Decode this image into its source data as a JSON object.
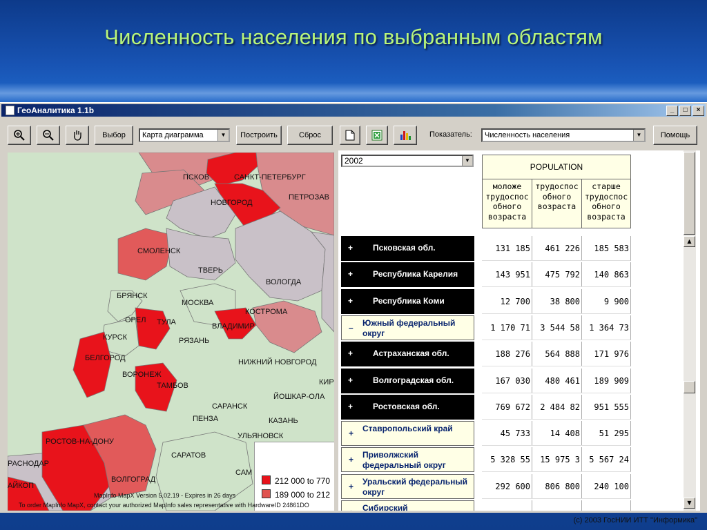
{
  "slide": {
    "title": "Численность населения по выбранным областям",
    "copyright": "(c) 2003 ГосНИИ ИТТ \"Информика\""
  },
  "window": {
    "title": "ГеоАналитика 1.1b",
    "controls": [
      "_",
      "□",
      "×"
    ]
  },
  "toolbar": {
    "select_label": "Выбор",
    "map_mode": "Карта диаграмма",
    "build_label": "Построить",
    "reset_label": "Сброс",
    "indicator_label": "Показатель:",
    "indicator_value": "Численность населения",
    "help_label": "Помощь",
    "icons": [
      "zoom-in-icon",
      "zoom-out-icon",
      "pan-hand-icon",
      "new-document-icon",
      "excel-icon",
      "chart-icon"
    ]
  },
  "map": {
    "labels": [
      "ПСКОВ",
      "САНКТ-ПЕТЕРБУРГ",
      "ПЕТРОЗАВ",
      "НОВГОРОД",
      "СМОЛЕНСК",
      "ТВЕРЬ",
      "ВОЛОГДА",
      "БРЯНСК",
      "МОСКВА",
      "КОСТРОМА",
      "ОРЕЛ",
      "ТУЛА",
      "ВЛАДИМИР",
      "КУРСК",
      "РЯЗАНЬ",
      "БЕЛГОРОД",
      "НИЖНИЙ НОВГОРОД",
      "ВОРОНЕЖ",
      "ТАМБОВ",
      "КИР",
      "ЙОШКАР-ОЛА",
      "САРАНСК",
      "ПЕНЗА",
      "КАЗАНЬ",
      "УЛЬЯНОВСК",
      "РОСТОВ-НА-ДОНУ",
      "САРАТОВ",
      "РАСНОДАР",
      "САМ",
      "ВОЛГОГРАД",
      "АЙКОП"
    ],
    "legend": [
      {
        "label": "212 000 to 770",
        "color": "#e8131b"
      },
      {
        "label": "189 000 to 212",
        "color": "#e0534f"
      }
    ],
    "note1": "MapInfo MapX Version 5.02.19 - Expires in 26 days",
    "note2": "To order MapInfo MapX, contact your authorized MapInfo sales representative with HardwareID 24861DO",
    "colors": {
      "high": "#e8131b",
      "mid": "#e15a5a",
      "low": "#d98b8d",
      "grey": "#c9c1c8",
      "green": "#cfe3c9"
    }
  },
  "table": {
    "year": "2002",
    "header": "POPULATION",
    "columns": [
      "моложе трудоспос обного возраста",
      "трудоспос обного возраста",
      "старше трудоспос обного возраста"
    ],
    "rows": [
      {
        "sign": "+",
        "name": "Псковская обл.",
        "style": "dark",
        "values": [
          "131 185",
          "461 226",
          "185 583"
        ]
      },
      {
        "sign": "+",
        "name": "Республика Карелия",
        "style": "dark",
        "values": [
          "143 951",
          "475 792",
          "140 863"
        ]
      },
      {
        "sign": "+",
        "name": "Республика Коми",
        "style": "dark",
        "values": [
          "12 700",
          "38 800",
          "9 900"
        ]
      },
      {
        "sign": "–",
        "name": "Южный федеральный округ",
        "style": "light",
        "values": [
          "1 170 71",
          "3 544 58",
          "1 364 73"
        ]
      },
      {
        "sign": "+",
        "name": "Астраханская обл.",
        "style": "dark",
        "values": [
          "188 276",
          "564 888",
          "171 976"
        ]
      },
      {
        "sign": "+",
        "name": "Волгоградская обл.",
        "style": "dark",
        "values": [
          "167 030",
          "480 461",
          "189 909"
        ]
      },
      {
        "sign": "+",
        "name": "Ростовская обл.",
        "style": "dark",
        "values": [
          "769 672",
          "2 484 82",
          "951 555"
        ]
      },
      {
        "sign": "+",
        "name": "Ставропольский край",
        "style": "light",
        "values": [
          "45 733",
          "14 408",
          "51 295"
        ]
      },
      {
        "sign": "+",
        "name": "Приволжский федеральный округ",
        "style": "light",
        "values": [
          "5 328 55",
          "15 975 3",
          "5 567 24"
        ]
      },
      {
        "sign": "+",
        "name": "Уральский федеральный округ",
        "style": "light",
        "values": [
          "292 600",
          "806 800",
          "240 100"
        ]
      },
      {
        "sign": "+",
        "name": "Сибирский",
        "style": "light",
        "values": [
          "",
          "",
          ""
        ]
      }
    ]
  }
}
